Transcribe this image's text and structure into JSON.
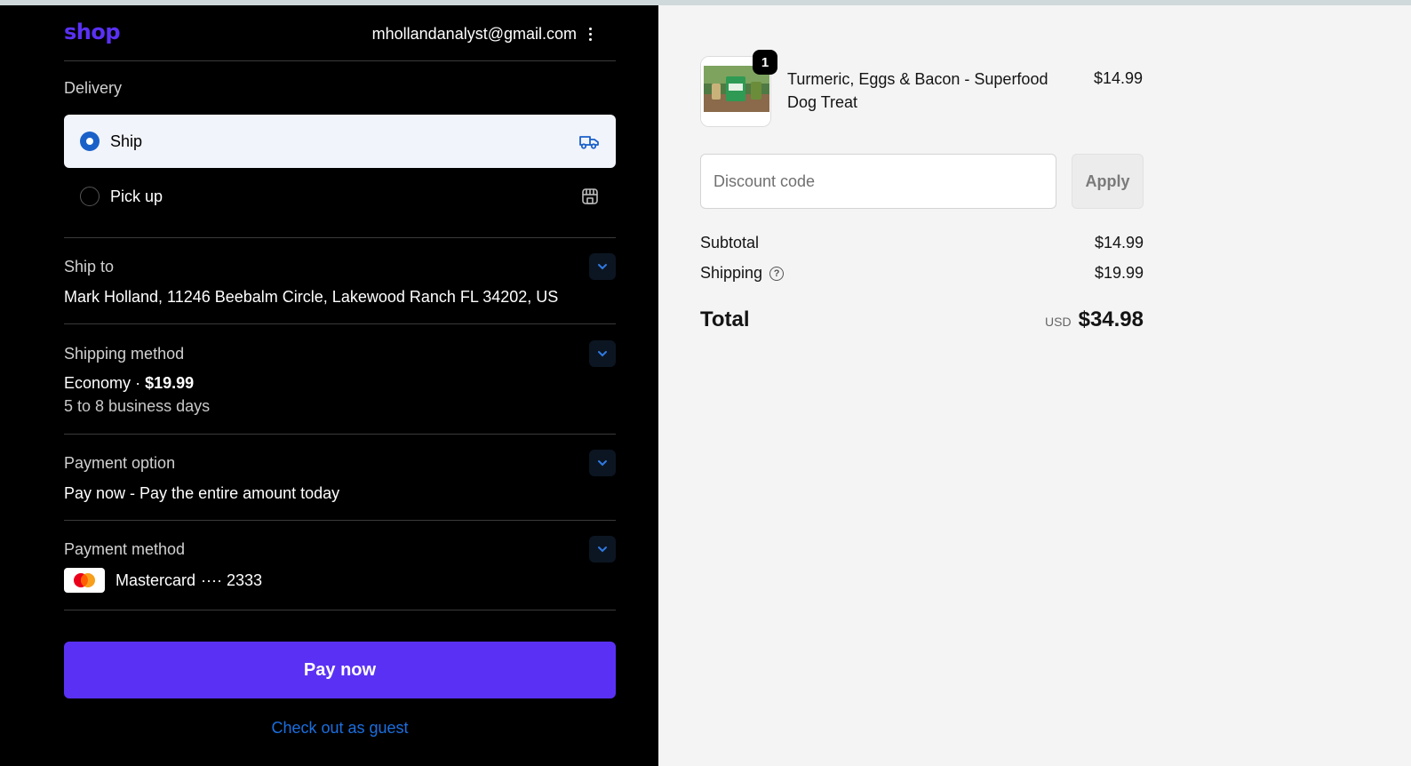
{
  "header": {
    "logo": "shop",
    "email": "mhollandanalyst@gmail.com"
  },
  "delivery": {
    "label": "Delivery",
    "options": [
      {
        "label": "Ship",
        "selected": true,
        "icon": "truck-icon"
      },
      {
        "label": "Pick up",
        "selected": false,
        "icon": "store-icon"
      }
    ]
  },
  "ship_to": {
    "label": "Ship to",
    "value": "Mark Holland, 11246 Beebalm Circle, Lakewood Ranch FL 34202, US"
  },
  "shipping_method": {
    "label": "Shipping method",
    "name": "Economy",
    "separator": "·",
    "price": "$19.99",
    "eta": "5 to 8 business days"
  },
  "payment_option": {
    "label": "Payment option",
    "value": "Pay now - Pay the entire amount today"
  },
  "payment_method": {
    "label": "Payment method",
    "card": "Mastercard",
    "masked": "···· 2333"
  },
  "actions": {
    "pay_now": "Pay now",
    "guest": "Check out as guest"
  },
  "order": {
    "quantity": "1",
    "product_name": "Turmeric, Eggs & Bacon - Superfood Dog Treat",
    "product_price": "$14.99",
    "discount_placeholder": "Discount code",
    "apply": "Apply",
    "subtotal_label": "Subtotal",
    "subtotal": "$14.99",
    "shipping_label": "Shipping",
    "shipping": "$19.99",
    "total_label": "Total",
    "currency": "USD",
    "total": "$34.98"
  },
  "colors": {
    "brand": "#5a31f4",
    "link": "#1a6fe0",
    "radio": "#1a60c9"
  }
}
